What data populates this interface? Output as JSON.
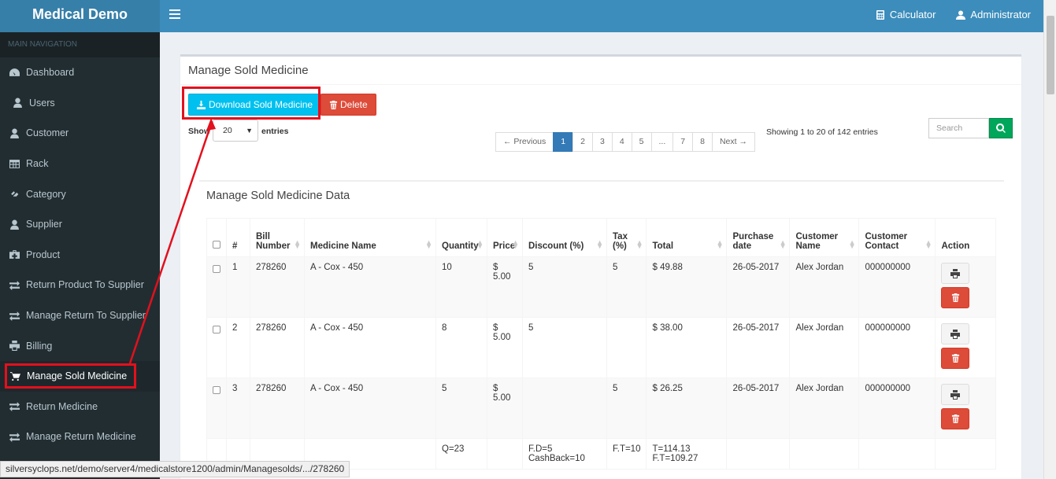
{
  "brand": {
    "title": "Medical Demo"
  },
  "topbar": {
    "calculator_label": "Calculator",
    "user_label": "Administrator"
  },
  "sidebar": {
    "header": "MAIN NAVIGATION",
    "items": [
      {
        "label": "Dashboard",
        "icon": "dashboard-icon"
      },
      {
        "label": "Users",
        "icon": "user-icon"
      },
      {
        "label": "Customer",
        "icon": "user-icon"
      },
      {
        "label": "Rack",
        "icon": "table-icon"
      },
      {
        "label": "Category",
        "icon": "link-icon"
      },
      {
        "label": "Supplier",
        "icon": "user-icon"
      },
      {
        "label": "Product",
        "icon": "medkit-icon"
      },
      {
        "label": "Return Product To Supplier",
        "icon": "exchange-icon"
      },
      {
        "label": "Manage Return To Supplier",
        "icon": "exchange-icon"
      },
      {
        "label": "Billing",
        "icon": "print-icon"
      },
      {
        "label": "Manage Sold Medicine",
        "icon": "cart-icon",
        "active": true
      },
      {
        "label": "Return Medicine",
        "icon": "exchange-icon"
      },
      {
        "label": "Manage Return Medicine",
        "icon": "exchange-icon"
      }
    ]
  },
  "page": {
    "title": "Manage Sold Medicine",
    "download_label": "Download Sold Medicine",
    "delete_label": "Delete",
    "show_label": "Show",
    "entries_value": "20",
    "entries_label": "entries",
    "search_placeholder": "Search",
    "info": "Showing 1 to 20 of 142 entries",
    "pagination": [
      "← Previous",
      "1",
      "2",
      "3",
      "4",
      "5",
      "...",
      "7",
      "8",
      "Next →"
    ],
    "active_page": "1"
  },
  "table": {
    "title": "Manage Sold Medicine Data",
    "columns": [
      "",
      "#",
      "Bill Number",
      "Medicine Name",
      "Quantity",
      "Price",
      "Discount (%)",
      "Tax (%)",
      "Total",
      "Purchase date",
      "Customer Name",
      "Customer Contact",
      "Action"
    ],
    "rows": [
      {
        "no": "1",
        "bill": "278260",
        "medicine": "A - Cox - 450",
        "qty": "10",
        "price": "$ 5.00",
        "discount": "5",
        "tax": "5",
        "total": "$ 49.88",
        "date": "26-05-2017",
        "customer": "Alex Jordan",
        "contact": "000000000"
      },
      {
        "no": "2",
        "bill": "278260",
        "medicine": "A - Cox - 450",
        "qty": "8",
        "price": "$ 5.00",
        "discount": "5",
        "tax": "",
        "total": "$ 38.00",
        "date": "26-05-2017",
        "customer": "Alex Jordan",
        "contact": "000000000"
      },
      {
        "no": "3",
        "bill": "278260",
        "medicine": "A - Cox - 450",
        "qty": "5",
        "price": "$ 5.00",
        "discount": "",
        "tax": "5",
        "total": "$ 26.25",
        "date": "26-05-2017",
        "customer": "Alex Jordan",
        "contact": "000000000"
      }
    ],
    "summary": {
      "qty": "Q=23",
      "discount_line1": "F.D=5",
      "discount_line2": "CashBack=10",
      "tax": "F.T=10",
      "total_line1": "T=114.13",
      "total_line2": "F.T=109.27"
    }
  },
  "status_url": "silversyclops.net/demo/server4/medicalstore1200/admin/Managesolds/.../278260",
  "colors": {
    "primary": "#3c8dbc",
    "sidebar": "#222d32",
    "info_button": "#00c0ef",
    "danger": "#dd4b39",
    "success": "#00a65a",
    "annotation": "#e3101d"
  }
}
